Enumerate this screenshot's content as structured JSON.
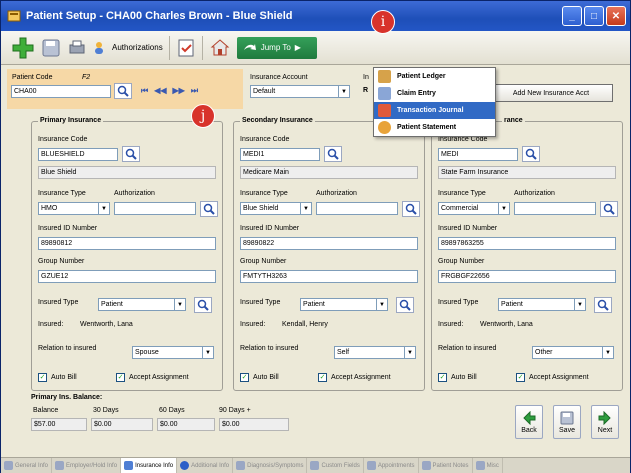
{
  "window": {
    "title": "Patient Setup - CHA00  Charles Brown - Blue Shield"
  },
  "toolbar": {
    "authorizations": "Authorizations",
    "jump_to": "Jump To"
  },
  "jump_menu": {
    "items": [
      {
        "label": "Patient Ledger"
      },
      {
        "label": "Claim Entry"
      },
      {
        "label": "Transaction Journal"
      },
      {
        "label": "Patient Statement"
      }
    ]
  },
  "header": {
    "patient_code_label": "Patient Code",
    "f2_hint": "F2",
    "patient_code_value": "CHA00",
    "insurance_account_label": "Insurance Account",
    "insurance_account_value": "Default",
    "truncated_label": "In",
    "truncated_value": "R",
    "add_account_button": "Add New Insurance Acct"
  },
  "callouts": {
    "i": "i",
    "j": "j"
  },
  "primary": {
    "title": "Primary Insurance",
    "code_label": "Insurance Code",
    "code_value": "BLUESHIELD",
    "name_value": "Blue Shield",
    "type_label": "Insurance Type",
    "type_value": "HMO",
    "auth_label": "Authorization",
    "auth_value": "",
    "id_label": "Insured ID Number",
    "id_value": "89890812",
    "group_label": "Group Number",
    "group_value": "GZUE12",
    "insured_type_label": "Insured Type",
    "insured_type_value": "Patient",
    "insured_label": "Insured:",
    "insured_value": "Wentworth, Lana",
    "relation_label": "Relation to insured",
    "relation_value": "Spouse",
    "auto_bill": "Auto Bill",
    "accept_assignment": "Accept Assignment"
  },
  "secondary": {
    "title": "Secondary Insurance",
    "code_label": "Insurance Code",
    "code_value": "MEDI1",
    "name_value": "Medicare Main",
    "type_label": "Insurance Type",
    "type_value": "Blue Shield",
    "auth_label": "Authorization",
    "auth_value": "",
    "id_label": "Insured ID Number",
    "id_value": "89890822",
    "group_label": "Group Number",
    "group_value": "FMTYTH3263",
    "insured_type_label": "Insured Type",
    "insured_type_value": "Patient",
    "insured_label": "Insured:",
    "insured_value": "Kendall, Henry",
    "relation_label": "Relation to insured",
    "relation_value": "Self",
    "auto_bill": "Auto Bill",
    "accept_assignment": "Accept Assignment"
  },
  "tertiary": {
    "title": "rance",
    "code_label": "Insurance Code",
    "code_value": "MEDI",
    "name_value": "State Farm Insurance",
    "type_label": "Insurance Type",
    "type_value": "Commercial",
    "auth_label": "Authorization",
    "auth_value": "",
    "id_label": "Insured ID Number",
    "id_value": "89897863255",
    "group_label": "Group Number",
    "group_value": "FRGBGF22656",
    "insured_type_label": "Insured Type",
    "insured_type_value": "Patient",
    "insured_label": "Insured:",
    "insured_value": "Wentworth, Lana",
    "relation_label": "Relation to insured",
    "relation_value": "Other",
    "auto_bill": "Auto Bill",
    "accept_assignment": "Accept Assignment"
  },
  "balance": {
    "title": "Primary Ins. Balance:",
    "headers": [
      "Balance",
      "30 Days",
      "60 Days",
      "90 Days +"
    ],
    "values": [
      "$57.00",
      "$0.00",
      "$0.00",
      "$0.00"
    ]
  },
  "nav_buttons": {
    "back": "Back",
    "save": "Save",
    "next": "Next"
  },
  "tabs": [
    {
      "label": "General Info"
    },
    {
      "label": "Employer/Hold Info"
    },
    {
      "label": "Insurance Info"
    },
    {
      "label": "Additional Info"
    },
    {
      "label": "Diagnosis/Symptoms"
    },
    {
      "label": "Custom Fields"
    },
    {
      "label": "Appointments"
    },
    {
      "label": "Patient Notes"
    },
    {
      "label": "Misc"
    }
  ],
  "colors": {
    "title_bar": "#2356c6",
    "header_panel": "#f6d8a6",
    "menu_selection": "#316ac5",
    "callout": "#d8332b"
  }
}
